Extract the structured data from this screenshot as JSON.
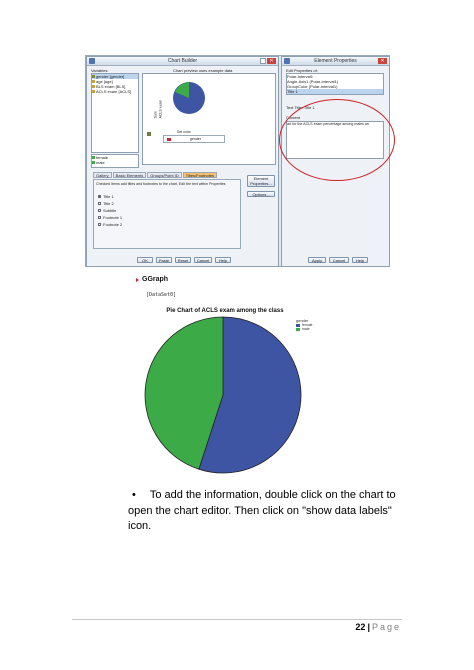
{
  "chart_builder": {
    "title": "Chart Builder",
    "variables_label": "Variables:",
    "variables": [
      "gender [gender]",
      "age [age]",
      "BLS exam [BLS]",
      "ACLS exam [ACLS]"
    ],
    "preview_caption": "Chart preview uses example data",
    "preview_axis": "Sum\nACLS exam",
    "preview_slice_label": "Set color",
    "preview_legend": "gender",
    "categories": [
      "female",
      "male"
    ],
    "tabs": [
      "Gallery",
      "Basic Elements",
      "Groups/Point ID",
      "Titles/Footnotes"
    ],
    "active_tab": 3,
    "instruction": "Checked items add titles and footnotes to the chart. Edit the text within Properties",
    "checkboxes": [
      "Title 1",
      "Title 2",
      "Subtitle",
      "Footnote 1",
      "Footnote 2"
    ],
    "side_buttons": [
      "Element Properties...",
      "Options..."
    ],
    "bottom_buttons": [
      "OK",
      "Paste",
      "Reset",
      "Cancel",
      "Help"
    ]
  },
  "element_properties": {
    "title": "Element Properties",
    "edit_label": "Edit Properties of:",
    "edit_items": [
      "Polar-Interval1",
      "Angle-Axis1 (Polar-Interval1)",
      "GroupColor (Polar-Interval1)",
      "Title 1"
    ],
    "text_label": "Text Title: Title 1",
    "content_label": "Content",
    "content_value": "art for the ACLS exam percentage among males an",
    "buttons": [
      "Apply",
      "Cancel",
      "Help"
    ]
  },
  "output": {
    "ggraph_label": "GGraph",
    "dataset": "[DataSet0]"
  },
  "chart_data": {
    "type": "pie",
    "title": "Pie Chart of ACLS exam among the class",
    "legend_title": "gender",
    "legend_position": "top-right",
    "categories": [
      "female",
      "male"
    ],
    "values": [
      55,
      45
    ],
    "colors": [
      "#3e55a4",
      "#3daa48"
    ]
  },
  "body_text": {
    "bullet": "•",
    "line1": "To add the information, double click on the chart to",
    "line2": "open the chart editor. Then click on \"show data labels\" icon."
  },
  "footer": {
    "page_number": "22",
    "separator": "|",
    "page_word": "Page"
  }
}
